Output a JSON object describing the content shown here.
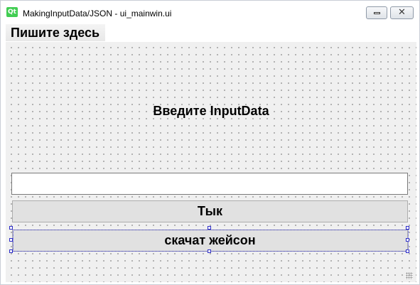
{
  "window": {
    "app_icon": "qt-logo-icon",
    "app_icon_text": "Qt",
    "title": "MakingInputData/JSON - ui_mainwin.ui",
    "controls": {
      "minimize_icon": "minimize-icon",
      "close_icon": "close-icon",
      "close_glyph": "✕"
    }
  },
  "menubar": {
    "items": [
      {
        "label": "Пишите здесь"
      }
    ]
  },
  "form": {
    "prompt_label": "Введите InputData",
    "input": {
      "value": "",
      "placeholder": ""
    },
    "buttons": [
      {
        "label": "Тык"
      },
      {
        "label": "скачат жейсон",
        "selected": true
      }
    ]
  },
  "colors": {
    "form_background": "#f0f0f0",
    "button_background": "#e1e1e1",
    "selection_handle": "#2c2cc8",
    "qt_green": "#41cd52"
  }
}
